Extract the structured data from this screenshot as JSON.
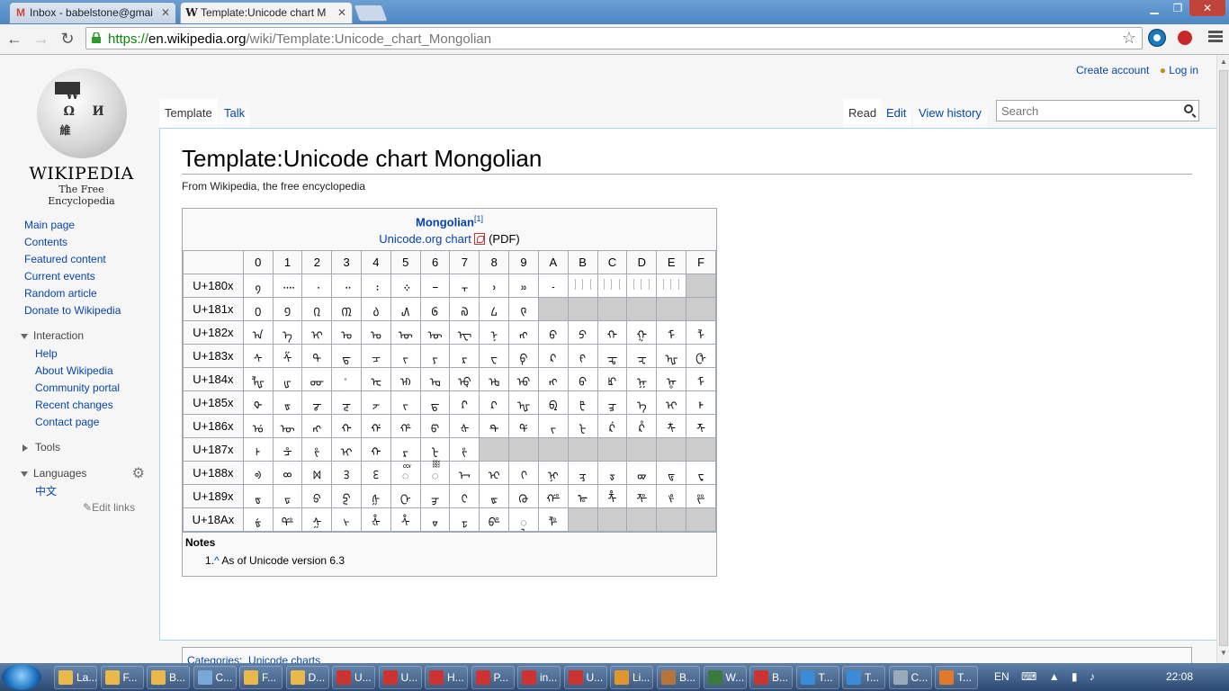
{
  "browser": {
    "tabs": [
      {
        "title": "Inbox - babelstone@gmai",
        "active": false,
        "favicon": "gmail-icon"
      },
      {
        "title": "Template:Unicode chart M",
        "active": true,
        "favicon": "wikipedia-icon"
      }
    ],
    "window_buttons": [
      "minimize-icon",
      "restore-icon",
      "close-icon"
    ],
    "url": {
      "scheme": "https://",
      "host": "en.wikipedia.org",
      "path": "/wiki/Template:Unicode_chart_Mongolian"
    }
  },
  "personal": {
    "create_account": "Create account",
    "log_in": "Log in"
  },
  "logo": {
    "wordmark": "Wikipedia",
    "tagline": "The Free Encyclopedia"
  },
  "nav": {
    "main": [
      "Main page",
      "Contents",
      "Featured content",
      "Current events",
      "Random article",
      "Donate to Wikipedia"
    ],
    "interaction_head": "Interaction",
    "interaction": [
      "Help",
      "About Wikipedia",
      "Community portal",
      "Recent changes",
      "Contact page"
    ],
    "tools_head": "Tools",
    "languages_head": "Languages",
    "languages": [
      "中文"
    ],
    "edit_links": "Edit links"
  },
  "tabs": {
    "left": [
      "Template",
      "Talk"
    ],
    "right": [
      "Read",
      "Edit",
      "View history"
    ],
    "search_placeholder": "Search"
  },
  "page": {
    "title": "Template:Unicode chart Mongolian",
    "subtitle": "From Wikipedia, the free encyclopedia"
  },
  "chart": {
    "title": "Mongolian",
    "title_ref": "[1]",
    "chart_link": "Unicode.org chart",
    "pdf_label": "(PDF)",
    "columns": [
      "0",
      "1",
      "2",
      "3",
      "4",
      "5",
      "6",
      "7",
      "8",
      "9",
      "A",
      "B",
      "C",
      "D",
      "E",
      "F"
    ],
    "rows": [
      {
        "label": "U+180x",
        "cells": [
          "᠀",
          "᠁",
          "᠂",
          "᠃",
          "᠄",
          "᠅",
          "᠆",
          "᠇",
          "᠈",
          "᠉",
          "᠊",
          "FVS",
          "FVS",
          "FVS",
          "MVS",
          ""
        ]
      },
      {
        "label": "U+181x",
        "cells": [
          "᠐",
          "᠑",
          "᠒",
          "᠓",
          "᠔",
          "᠕",
          "᠖",
          "᠗",
          "᠘",
          "᠙",
          "",
          "",
          "",
          "",
          "",
          ""
        ]
      },
      {
        "label": "U+182x",
        "cells": [
          "ᠠ",
          "ᠡ",
          "ᠢ",
          "ᠣ",
          "ᠤ",
          "ᠥ",
          "ᠦ",
          "ᠧ",
          "ᠨ",
          "ᠩ",
          "ᠪ",
          "ᠫ",
          "ᠬ",
          "ᠭ",
          "ᠮ",
          "ᠯ"
        ]
      },
      {
        "label": "U+183x",
        "cells": [
          "ᠰ",
          "ᠱ",
          "ᠲ",
          "ᠳ",
          "ᠴ",
          "ᠵ",
          "ᠶ",
          "ᠷ",
          "ᠸ",
          "ᠹ",
          "ᠺ",
          "ᠻ",
          "ᠼ",
          "ᠽ",
          "ᠾ",
          "ᠿ"
        ]
      },
      {
        "label": "U+184x",
        "cells": [
          "ᡀ",
          "ᡁ",
          "ᡂ",
          "ᡃ",
          "ᡄ",
          "ᡅ",
          "ᡆ",
          "ᡇ",
          "ᡈ",
          "ᡉ",
          "ᡊ",
          "ᡋ",
          "ᡌ",
          "ᡍ",
          "ᡎ",
          "ᡏ"
        ]
      },
      {
        "label": "U+185x",
        "cells": [
          "ᡐ",
          "ᡑ",
          "ᡒ",
          "ᡓ",
          "ᡔ",
          "ᡕ",
          "ᡖ",
          "ᡗ",
          "ᡘ",
          "ᡙ",
          "ᡚ",
          "ᡛ",
          "ᡜ",
          "ᡝ",
          "ᡞ",
          "ᡟ"
        ]
      },
      {
        "label": "U+186x",
        "cells": [
          "ᡠ",
          "ᡡ",
          "ᡢ",
          "ᡣ",
          "ᡤ",
          "ᡥ",
          "ᡦ",
          "ᡧ",
          "ᡨ",
          "ᡩ",
          "ᡪ",
          "ᡫ",
          "ᡬ",
          "ᡭ",
          "ᡮ",
          "ᡯ"
        ]
      },
      {
        "label": "U+187x",
        "cells": [
          "ᡰ",
          "ᡱ",
          "ᡲ",
          "ᡳ",
          "ᡴ",
          "ᡵ",
          "ᡶ",
          "ᡷ",
          "",
          "",
          "",
          "",
          "",
          "",
          "",
          ""
        ]
      },
      {
        "label": "U+188x",
        "cells": [
          "ᢀ",
          "ᢁ",
          "ᢂ",
          "ᢃ",
          "ᢄ",
          "ᢅ",
          "ᢆ",
          "ᢇ",
          "ᢈ",
          "ᢉ",
          "ᢊ",
          "ᢋ",
          "ᢌ",
          "ᢍ",
          "ᢎ",
          "ᢏ"
        ]
      },
      {
        "label": "U+189x",
        "cells": [
          "ᢐ",
          "ᢑ",
          "ᢒ",
          "ᢓ",
          "ᢔ",
          "ᢕ",
          "ᢖ",
          "ᢗ",
          "ᢘ",
          "ᢙ",
          "ᢚ",
          "ᢛ",
          "ᢜ",
          "ᢝ",
          "ᢞ",
          "ᢟ"
        ]
      },
      {
        "label": "U+18Ax",
        "cells": [
          "ᢠ",
          "ᢡ",
          "ᢢ",
          "ᢣ",
          "ᢤ",
          "ᢥ",
          "ᢦ",
          "ᢧ",
          "ᢨ",
          "◌ᢩ",
          "ᢪ",
          "",
          "",
          "",
          "",
          ""
        ]
      }
    ],
    "unassigned": {
      "U+180x": [
        "F"
      ],
      "U+181x": [
        "A",
        "B",
        "C",
        "D",
        "E",
        "F"
      ],
      "U+187x": [
        "8",
        "9",
        "A",
        "B",
        "C",
        "D",
        "E",
        "F"
      ],
      "U+18Ax": [
        "B",
        "C",
        "D",
        "E",
        "F"
      ]
    },
    "notes_head": "Notes",
    "note_number": "1.",
    "note_caret": "^",
    "note_text": "As of Unicode version 6.3"
  },
  "categories": {
    "label": "Categories",
    "items": [
      "Unicode charts"
    ]
  },
  "taskbar": {
    "items": [
      "La...",
      "F...",
      "B...",
      "C...",
      "F...",
      "D...",
      "U...",
      "U...",
      "H...",
      "P...",
      "in...",
      "U...",
      "Li...",
      "B...",
      "W...",
      "B...",
      "T...",
      "T...",
      "C...",
      "T..."
    ],
    "lang": "EN",
    "time": "22:08"
  }
}
